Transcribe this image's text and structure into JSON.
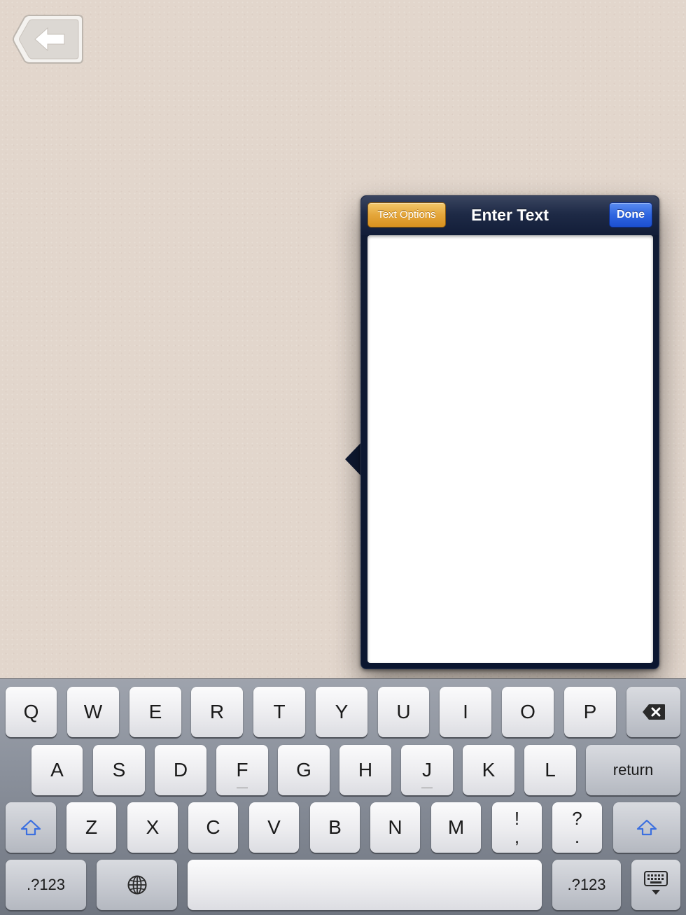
{
  "popover": {
    "text_options_label": "Text Options",
    "title": "Enter Text",
    "done_label": "Done",
    "text_value": ""
  },
  "keyboard": {
    "row1": [
      "Q",
      "W",
      "E",
      "R",
      "T",
      "Y",
      "U",
      "I",
      "O",
      "P"
    ],
    "row2": [
      "A",
      "S",
      "D",
      "F",
      "G",
      "H",
      "J",
      "K",
      "L"
    ],
    "return_label": "return",
    "row3": [
      "Z",
      "X",
      "C",
      "V",
      "B",
      "N",
      "M"
    ],
    "punct1_top": "!",
    "punct1_bottom": ",",
    "punct2_top": "?",
    "punct2_bottom": ".",
    "numbers_label": ".?123"
  },
  "icons": {
    "back": "back-arrow-icon",
    "backspace": "backspace-icon",
    "shift": "shift-icon",
    "globe": "globe-icon",
    "hide_keyboard": "hide-keyboard-icon"
  },
  "colors": {
    "background": "#e2d6cc",
    "popover": "#0f1a33",
    "text_options_button": "#e4a63b",
    "done_button": "#2f66e0",
    "shift_icon": "#3b6fe0"
  }
}
